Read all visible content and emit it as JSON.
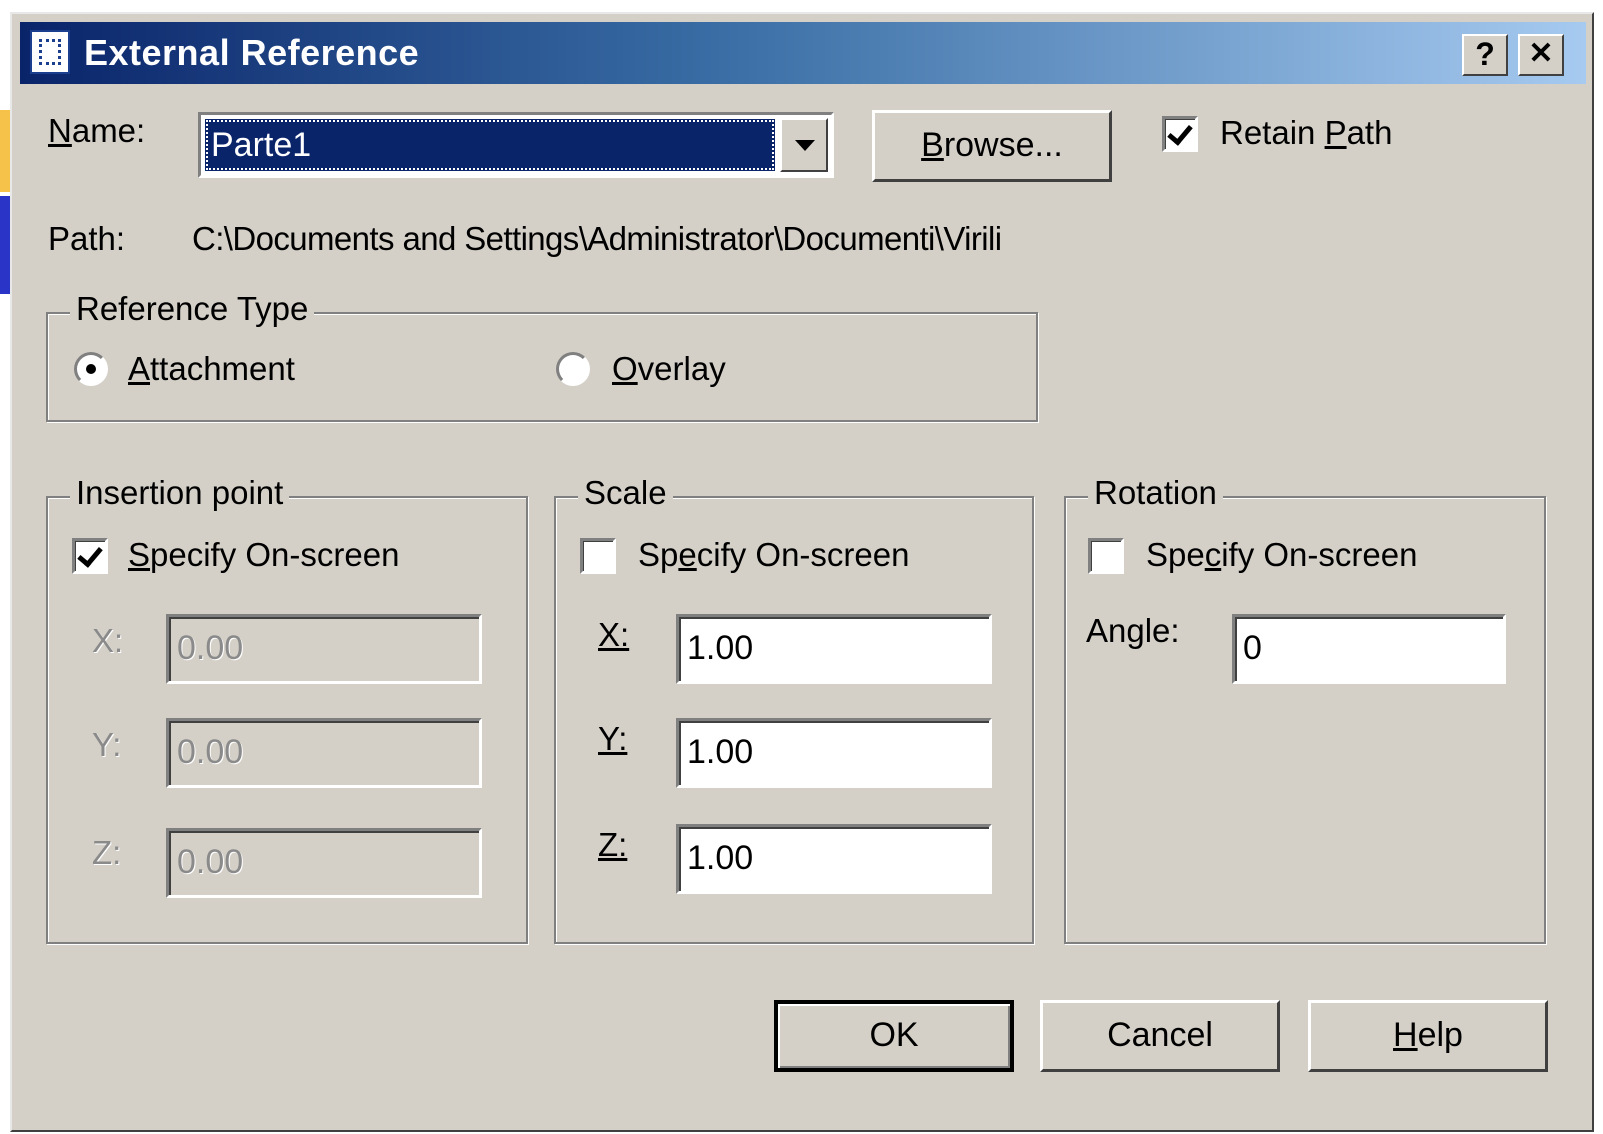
{
  "window": {
    "title": "External Reference",
    "help_glyph": "?",
    "close_glyph": "✕"
  },
  "name_row": {
    "label_u": "N",
    "label_rest": "ame:",
    "value": "Parte1"
  },
  "browse": {
    "label_u": "B",
    "label_rest": "rowse..."
  },
  "retain_path": {
    "checked": true,
    "label_a": "Retain ",
    "label_u": "P",
    "label_b": "ath"
  },
  "path_row": {
    "label": "Path:",
    "value": "C:\\Documents and Settings\\Administrator\\Documenti\\Virili"
  },
  "reference_type": {
    "title": "Reference Type",
    "attachment": {
      "selected": true,
      "label_u": "A",
      "label_rest": "ttachment"
    },
    "overlay": {
      "selected": false,
      "label_u": "O",
      "label_rest": "verlay"
    }
  },
  "insertion_point": {
    "title": "Insertion point",
    "specify": {
      "checked": true,
      "label_u": "S",
      "label_rest": "pecify On-screen"
    },
    "x_label": "X:",
    "x_value": "0.00",
    "y_label": "Y:",
    "y_value": "0.00",
    "z_label": "Z:",
    "z_value": "0.00"
  },
  "scale": {
    "title": "Scale",
    "specify": {
      "checked": false,
      "label_a": "Sp",
      "label_u": "e",
      "label_b": "cify On-screen"
    },
    "x_label": "X:",
    "x_value": "1.00",
    "y_label": "Y:",
    "y_value": "1.00",
    "z_label": "Z:",
    "z_value": "1.00"
  },
  "rotation": {
    "title": "Rotation",
    "specify": {
      "checked": false,
      "label_a": "Spe",
      "label_u": "c",
      "label_b": "ify On-screen"
    },
    "angle_label": "Angle:",
    "angle_value": "0"
  },
  "buttons": {
    "ok": "OK",
    "cancel": "Cancel",
    "help_u": "H",
    "help_rest": "elp"
  }
}
